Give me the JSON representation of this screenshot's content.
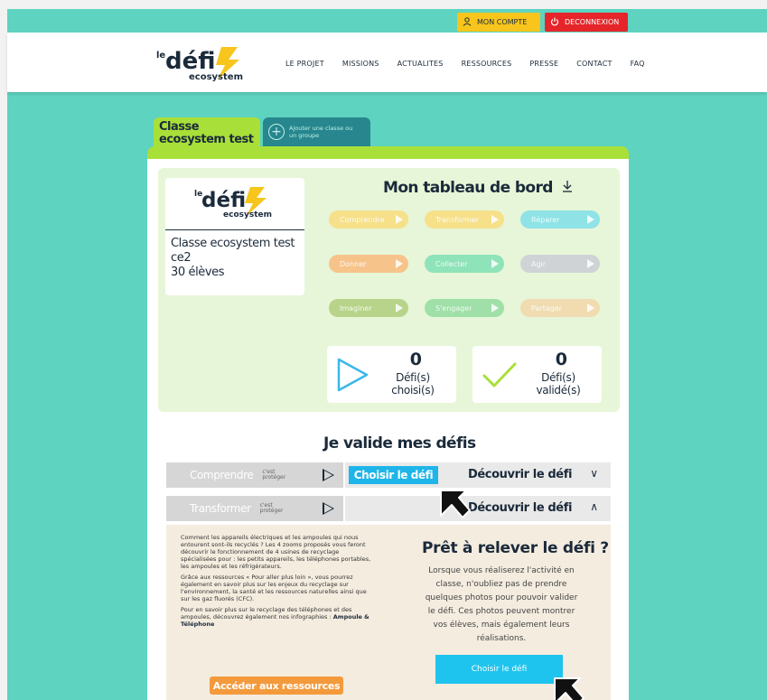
{
  "top_bar": {
    "account_label": "MON COMPTE",
    "logout_label": "DECONNEXION"
  },
  "brand": {
    "logo_prefix": "le",
    "logo_main": "défi",
    "logo_sub": "ecosystem"
  },
  "nav": {
    "items": [
      "LE PROJET",
      "MISSIONS",
      "ACTUALITES",
      "RESSOURCES",
      "PRESSE",
      "CONTACT",
      "FAQ"
    ]
  },
  "class_tabs": {
    "active_label": "Classe ecosystem test",
    "add_label": "Ajouter une classe ou un groupe"
  },
  "dashboard": {
    "title": "Mon tableau de bord",
    "class_name": "Classe ecosystem test",
    "level": "ce2",
    "students": "30 élèves",
    "pills": [
      {
        "label": "Comprendre",
        "color": "#f6e08a"
      },
      {
        "label": "Transformer",
        "color": "#f6e08a"
      },
      {
        "label": "Réparer",
        "color": "#8fe3e6"
      },
      {
        "label": "Donner",
        "color": "#f6c48a"
      },
      {
        "label": "Collecter",
        "color": "#8fe3b8"
      },
      {
        "label": "Agir",
        "color": "#cfd3d6"
      },
      {
        "label": "Imaginer",
        "color": "#b7d48a"
      },
      {
        "label": "S'engager",
        "color": "#9fe0a8"
      },
      {
        "label": "Partager",
        "color": "#f0dcb0"
      }
    ],
    "chosen_count": "0",
    "chosen_label": "Défi(s) choisi(s)",
    "validated_count": "0",
    "validated_label": "Défi(s) validé(s)"
  },
  "validate": {
    "title": "Je valide mes défis",
    "rows": [
      {
        "name": "Comprendre",
        "tag": "c'est protéger",
        "choose": "Choisir le défi",
        "discover": "Découvrir le défi"
      },
      {
        "name": "Transformer",
        "tag": "c'est protéger",
        "discover": "Découvrir le défi"
      }
    ]
  },
  "detail": {
    "paragraph1": "Comment les appareils électriques et les ampoules qui nous entourent sont-ils recyclés ? Les 4 zooms proposés vous feront découvrir le fonctionnement de 4 usines de recyclage spécialisées pour : les petits appareils, les téléphones portables, les ampoules et les réfrigérateurs.",
    "paragraph2": "Grâce aux ressources « Pour aller plus loin », vous pourrez également en savoir plus sur les enjeux du recyclage sur l'environnement, la santé et les ressources naturelles ainsi que sur les gaz fluorés (CFC).",
    "paragraph3_lead": "Pour en savoir plus sur le recyclage des téléphones et des ampoules, découvrez également nos infographies :",
    "link_bulb": "Ampoule",
    "amp": "&",
    "link_phone": "Téléphone",
    "resources_btn": "Accéder aux ressources",
    "ready_title": "Prêt à relever le défi ?",
    "ready_text": "Lorsque vous réaliserez l'activité en classe, n'oubliez pas de prendre quelques photos pour pouvoir valider le défi. Ces photos peuvent montrer vos élèves, mais également leurs réalisations.",
    "ready_btn": "Choisir le défi"
  },
  "colors": {
    "background": "#5ed3c0",
    "lime": "#a8e039",
    "yellow": "#f7c51c",
    "red": "#e5252a",
    "cyan": "#1fb5e8",
    "orange": "#f39a3c"
  }
}
